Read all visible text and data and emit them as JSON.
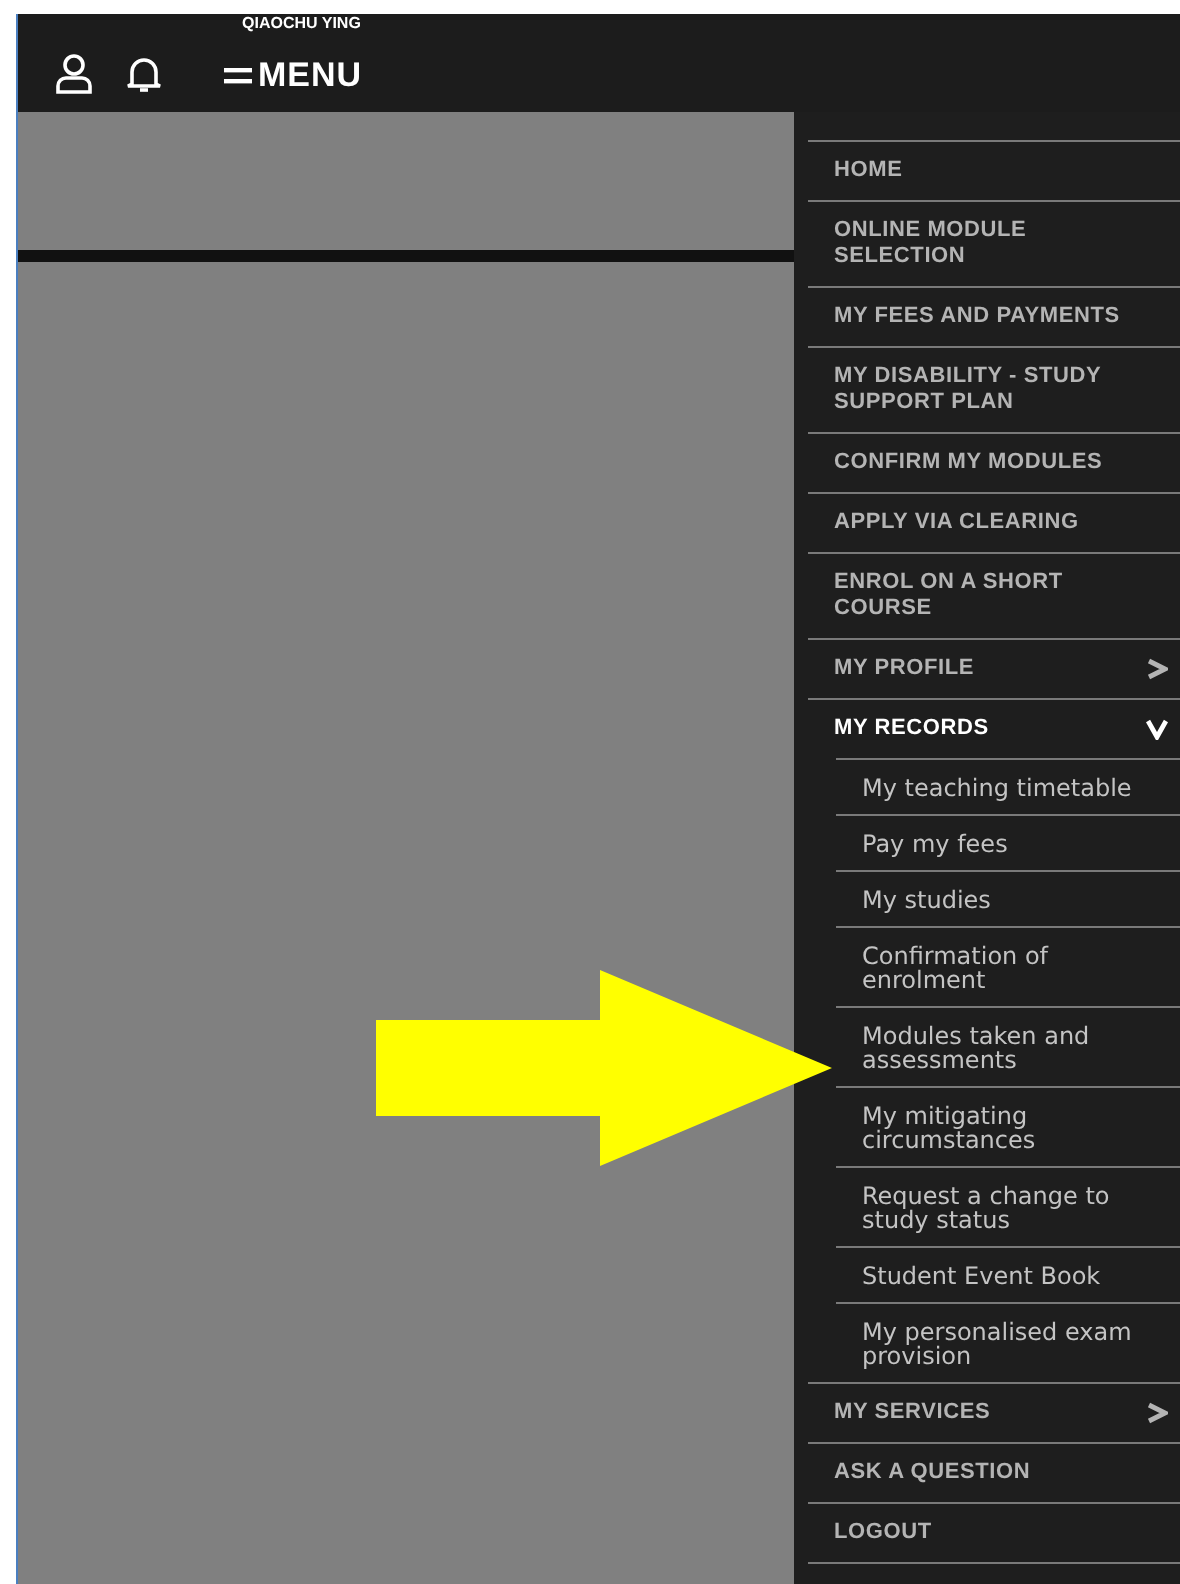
{
  "header": {
    "user_name": "QIAOCHU YING",
    "menu_label": "MENU"
  },
  "menu": {
    "items": [
      {
        "label": "HOME"
      },
      {
        "label": "ONLINE MODULE SELECTION"
      },
      {
        "label": "MY FEES AND PAYMENTS"
      },
      {
        "label": "MY DISABILITY - STUDY SUPPORT PLAN"
      },
      {
        "label": "CONFIRM MY MODULES"
      },
      {
        "label": "APPLY VIA CLEARING"
      },
      {
        "label": "ENROL ON A SHORT COURSE"
      },
      {
        "label": "MY PROFILE",
        "expanded": false
      },
      {
        "label": "MY RECORDS",
        "expanded": true,
        "children": [
          {
            "label": "My teaching timetable"
          },
          {
            "label": "Pay my fees"
          },
          {
            "label": "My studies"
          },
          {
            "label": "Confirmation of enrolment"
          },
          {
            "label": "Modules taken and assessments"
          },
          {
            "label": "My mitigating circumstances"
          },
          {
            "label": "Request a change to study status"
          },
          {
            "label": "Student Event Book"
          },
          {
            "label": "My personalised exam provision"
          }
        ]
      },
      {
        "label": "MY SERVICES",
        "expanded": false
      },
      {
        "label": "ASK A QUESTION"
      },
      {
        "label": "LOGOUT"
      }
    ]
  }
}
